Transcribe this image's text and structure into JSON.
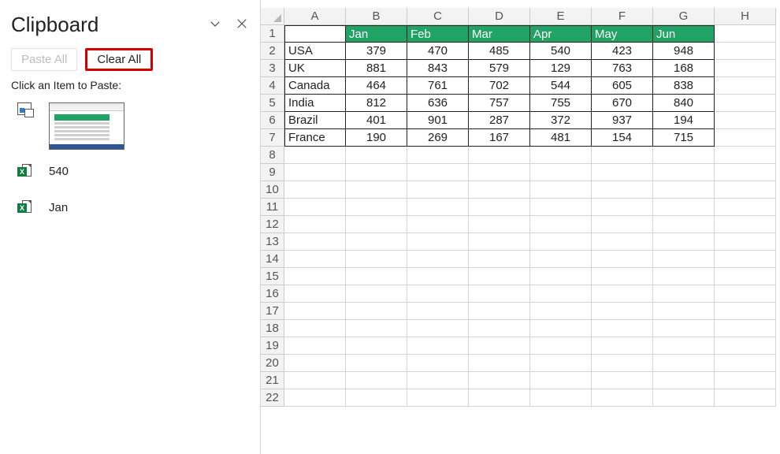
{
  "panel": {
    "title": "Clipboard",
    "paste_all_label": "Paste All",
    "clear_all_label": "Clear All",
    "hint": "Click an Item to Paste:"
  },
  "clipboard_items": [
    {
      "type": "image"
    },
    {
      "type": "text",
      "value": "540"
    },
    {
      "type": "text",
      "value": "Jan"
    }
  ],
  "columns": [
    "A",
    "B",
    "C",
    "D",
    "E",
    "F",
    "G",
    "H"
  ],
  "visible_rows": 22,
  "chart_data": {
    "type": "table",
    "months": [
      "Jan",
      "Feb",
      "Mar",
      "Apr",
      "May",
      "Jun"
    ],
    "rows": [
      {
        "country": "USA",
        "values": [
          379,
          470,
          485,
          540,
          423,
          948
        ]
      },
      {
        "country": "UK",
        "values": [
          881,
          843,
          579,
          129,
          763,
          168
        ]
      },
      {
        "country": "Canada",
        "values": [
          464,
          761,
          702,
          544,
          605,
          838
        ]
      },
      {
        "country": "India",
        "values": [
          812,
          636,
          757,
          755,
          670,
          840
        ]
      },
      {
        "country": "Brazil",
        "values": [
          401,
          901,
          287,
          372,
          937,
          194
        ]
      },
      {
        "country": "France",
        "values": [
          190,
          269,
          167,
          481,
          154,
          715
        ]
      }
    ]
  }
}
